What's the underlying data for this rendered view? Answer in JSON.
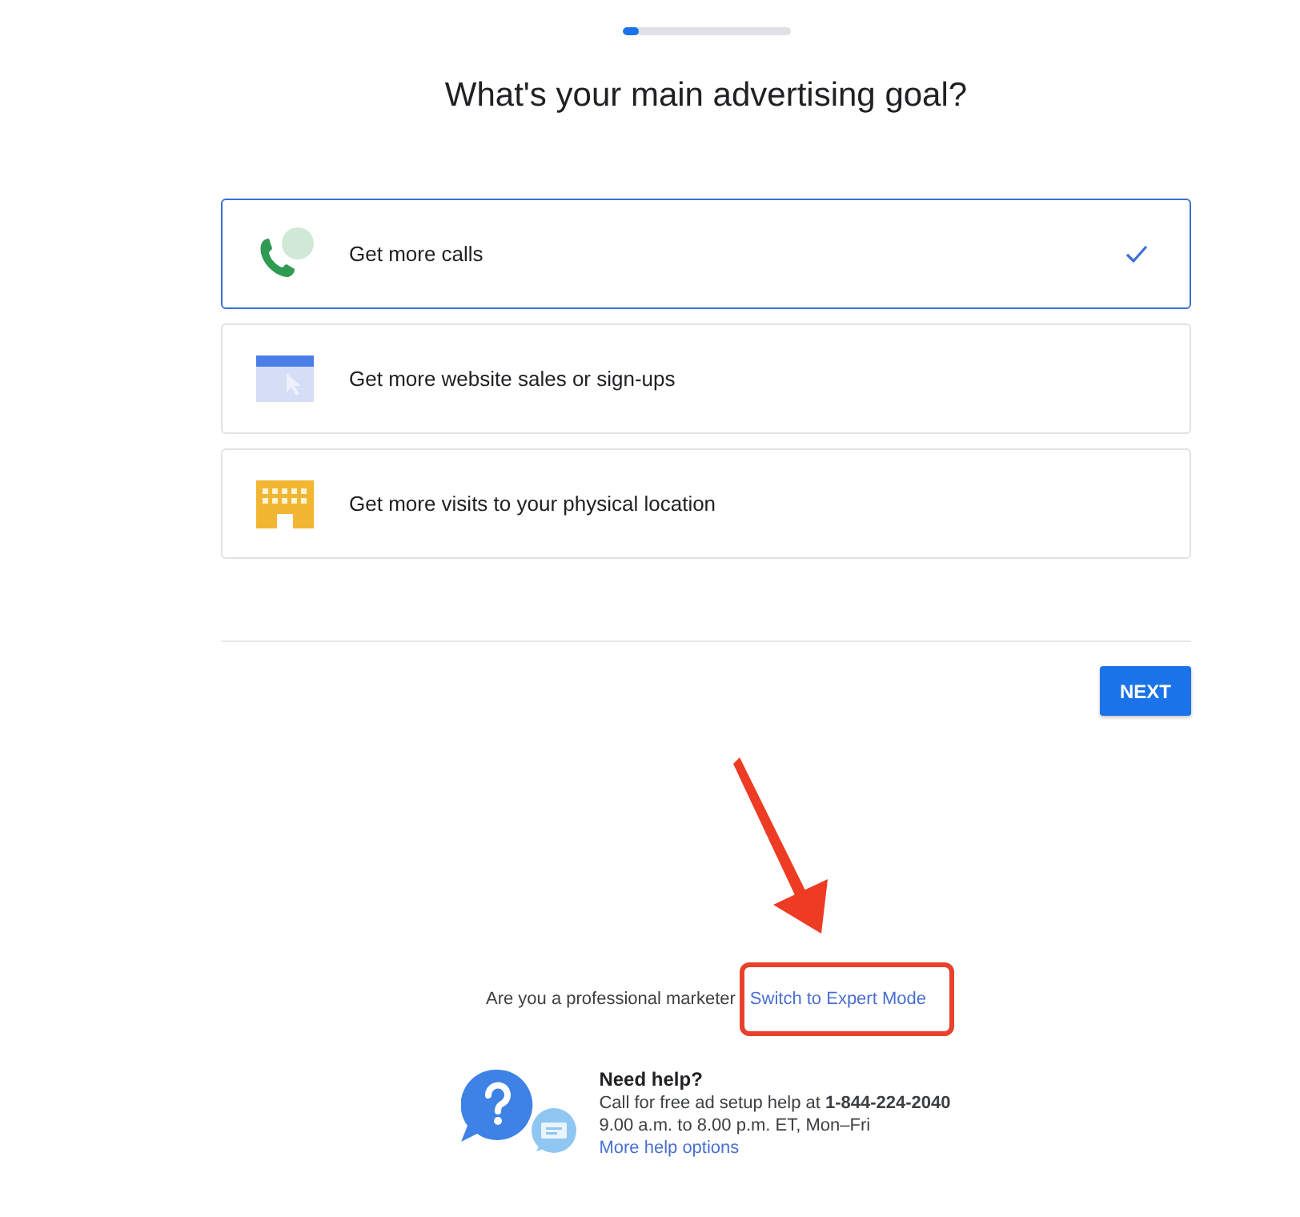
{
  "progress": {
    "level": 0.1
  },
  "title": "What's your main advertising goal?",
  "goals": [
    {
      "label": "Get more calls",
      "kind": "calls",
      "selected": true
    },
    {
      "label": "Get more website sales or sign-ups",
      "kind": "website",
      "selected": false
    },
    {
      "label": "Get more visits to your physical location",
      "kind": "visits",
      "selected": false
    }
  ],
  "next_button": "NEXT",
  "expert_mode": {
    "prompt": "Are you a professional marketer",
    "link": "Switch to Expert Mode"
  },
  "help": {
    "heading": "Need help?",
    "call_text": "Call for free ad setup help at **1-844-224-2040**",
    "hours": "9.00 a.m. to 8.00 p.m. ET, Mon–Fri",
    "link": "More help options"
  },
  "annotation": {
    "arrow": true,
    "highlight": true
  }
}
